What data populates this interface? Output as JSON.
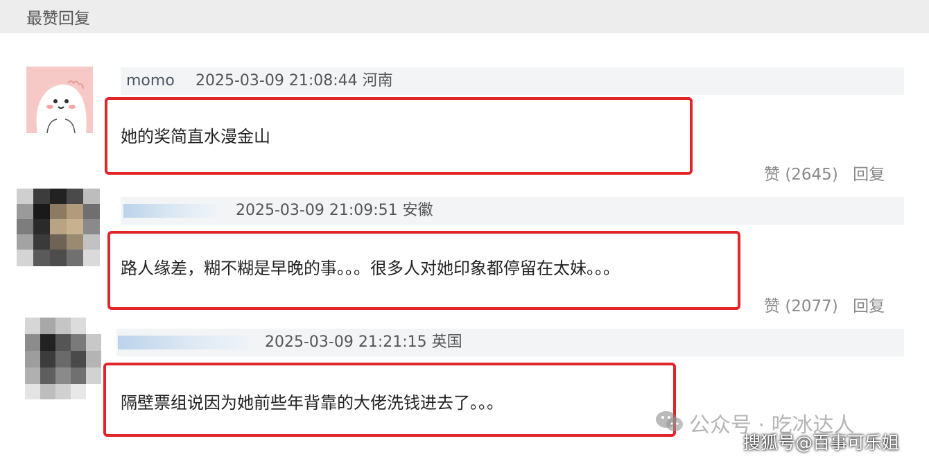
{
  "header": {
    "title": "最赞回复"
  },
  "comments": [
    {
      "username": "momo",
      "timestamp": "2025-03-09 21:08:44",
      "location": "河南",
      "text": "她的奖简直水漫金山",
      "like_label": "赞",
      "like_count": "(2645)",
      "reply_label": "回复"
    },
    {
      "username": "",
      "timestamp": "2025-03-09 21:09:51",
      "location": "安徽",
      "text": "路人缘差，糊不糊是早晚的事。。。很多人对她印象都停留在太妹。。。",
      "like_label": "赞",
      "like_count": "(2077)",
      "reply_label": "回复"
    },
    {
      "username": "",
      "timestamp": "2025-03-09 21:21:15",
      "location": "英国",
      "text": "隔壁票组说因为她前些年背靠的大佬洗钱进去了。。。"
    }
  ],
  "watermark": {
    "line1": "公众号 · 吃冰达人",
    "line2": "搜狐号@百事可乐姐"
  },
  "colors": {
    "highlight_border": "#e0262b",
    "meta_bg": "#f2f4f6",
    "header_bg": "#ededed"
  }
}
